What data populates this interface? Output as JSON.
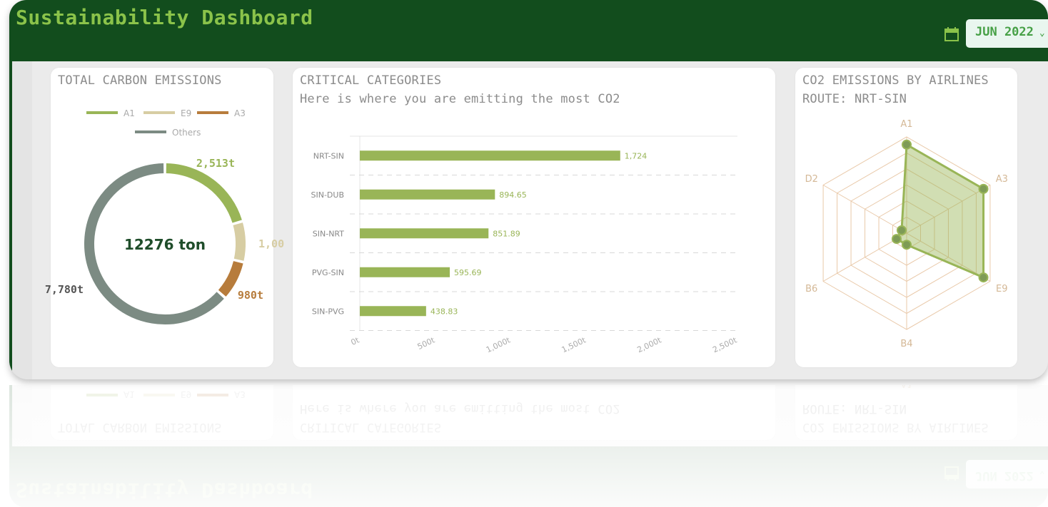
{
  "header": {
    "title": "Sustainability Dashboard",
    "month": "JUN 2022",
    "brand_color": "#124d1d",
    "accent_color": "#8bc34a"
  },
  "total_emissions": {
    "title": "TOTAL CARBON EMISSIONS",
    "center_label": "12276 ton",
    "legend": [
      {
        "name": "A1",
        "color": "#99b557"
      },
      {
        "name": "E9",
        "color": "#d7cda3"
      },
      {
        "name": "A3",
        "color": "#b77c3c"
      },
      {
        "name": "Others",
        "color": "#7c8b83"
      }
    ]
  },
  "critical_categories": {
    "title": "CRITICAL CATEGORIES",
    "subtitle": "Here is where you are emitting the most CO2"
  },
  "airlines": {
    "title": "CO2 EMISSIONS BY AIRLINES",
    "subtitle": "ROUTE: NRT-SIN"
  },
  "chart_data": [
    {
      "type": "pie",
      "donut": true,
      "categories": [
        "A1",
        "E9",
        "A3",
        "Others"
      ],
      "values": [
        2513,
        1003,
        980,
        7780
      ],
      "labels": [
        "2,513t",
        "1,00",
        "980t",
        "7,780t"
      ],
      "colors": [
        "#99b557",
        "#d7cda3",
        "#b77c3c",
        "#7c8b83"
      ]
    },
    {
      "type": "bar",
      "orientation": "horizontal",
      "categories": [
        "NRT-SIN",
        "SIN-DUB",
        "SIN-NRT",
        "PVG-SIN",
        "SIN-PVG"
      ],
      "values": [
        1724,
        894.65,
        851.89,
        595.69,
        438.83
      ],
      "value_labels": [
        "1,724",
        "894.65",
        "851.89",
        "595.69",
        "438.83"
      ],
      "xlim": [
        0,
        2500
      ],
      "xticks": [
        0,
        500,
        1000,
        1500,
        2000,
        2500
      ],
      "xtick_labels": [
        "0t",
        "500t",
        "1,000t",
        "1,500t",
        "2,000t",
        "2,500t"
      ],
      "color": "#99b557"
    },
    {
      "type": "radar",
      "axes": [
        "A1",
        "A3",
        "E9",
        "B4",
        "B6",
        "D2"
      ],
      "values": [
        0.92,
        0.92,
        0.92,
        0.12,
        0.12,
        0.06
      ],
      "rmax": 1,
      "color": "#99b557"
    }
  ]
}
